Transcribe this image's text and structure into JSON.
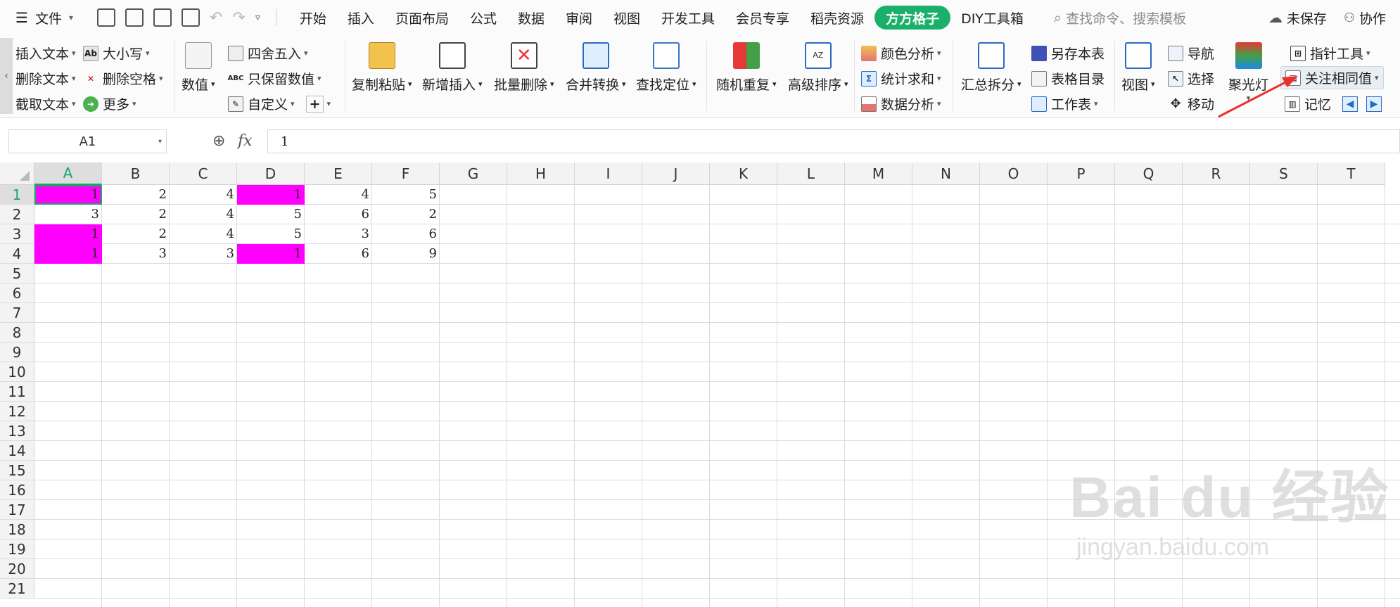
{
  "menubar": {
    "file_label": "文件",
    "tabs": [
      "开始",
      "插入",
      "页面布局",
      "公式",
      "数据",
      "审阅",
      "视图",
      "开发工具",
      "会员专享",
      "稻壳资源",
      "方方格子",
      "DIY工具箱"
    ],
    "active_tab": "方方格子",
    "search_placeholder": "查找命令、搜索模板",
    "unsaved_label": "未保存",
    "collab_label": "协作"
  },
  "ribbon": {
    "text_group": [
      "插入文本",
      "删除文本",
      "截取文本"
    ],
    "case_group": [
      "大小写",
      "删除空格",
      "更多"
    ],
    "numbers": {
      "value_label": "数值",
      "round_label": "四舍五入",
      "keep_numbers_label": "只保留数值",
      "custom_label": "自定义"
    },
    "big_buttons": [
      "复制粘贴",
      "新增插入",
      "批量删除",
      "合并转换",
      "查找定位",
      "随机重复",
      "高级排序"
    ],
    "analysis_group": [
      "颜色分析",
      "统计求和",
      "数据分析"
    ],
    "summary_label": "汇总拆分",
    "sheet_group": [
      "另存本表",
      "表格目录",
      "工作表"
    ],
    "view_label": "视图",
    "nav_group": [
      "导航",
      "选择",
      "移动"
    ],
    "spotlight_label": "聚光灯",
    "pointer_tool_label": "指针工具",
    "focus_same_label": "关注相同值",
    "memory_label": "记忆"
  },
  "formula_bar": {
    "name_box": "A1",
    "fx_label": "fx",
    "value": "1"
  },
  "sheet": {
    "columns": [
      "A",
      "B",
      "C",
      "D",
      "E",
      "F",
      "G",
      "H",
      "I",
      "J",
      "K",
      "L",
      "M",
      "N",
      "O",
      "P",
      "Q",
      "R",
      "S",
      "T"
    ],
    "rows": [
      "1",
      "2",
      "3",
      "4",
      "5",
      "6",
      "7",
      "8",
      "9",
      "10",
      "11",
      "12",
      "13",
      "14",
      "15",
      "16",
      "17",
      "18",
      "19",
      "20",
      "21"
    ],
    "cells": [
      [
        "1",
        "2",
        "4",
        "1",
        "4",
        "5"
      ],
      [
        "3",
        "2",
        "4",
        "5",
        "6",
        "2"
      ],
      [
        "1",
        "2",
        "4",
        "5",
        "3",
        "6"
      ],
      [
        "1",
        "3",
        "3",
        "1",
        "6",
        "9"
      ]
    ],
    "highlight_color": "#ff00ff",
    "highlighted": [
      [
        0,
        0
      ],
      [
        0,
        3
      ],
      [
        2,
        0
      ],
      [
        3,
        0
      ],
      [
        3,
        3
      ]
    ],
    "active_cell": [
      0,
      0
    ]
  },
  "watermark": {
    "main": "Bai du 经验",
    "sub": "jingyan.baidu.com"
  }
}
